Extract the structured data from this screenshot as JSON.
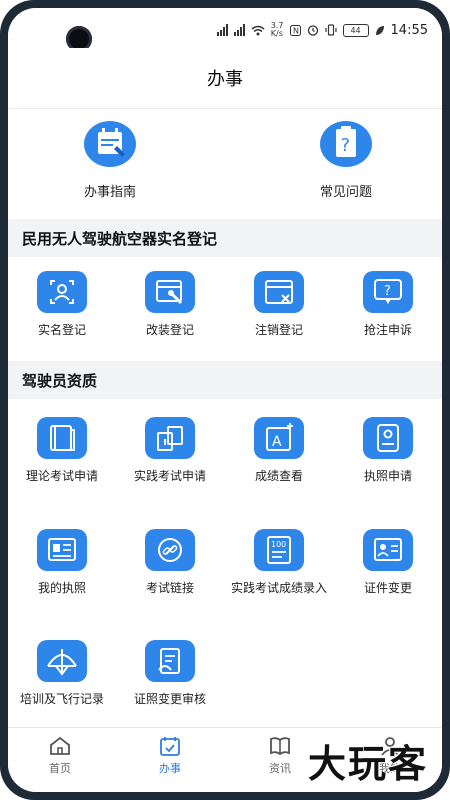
{
  "status": {
    "net": "3.7\nK/s",
    "battery": "44",
    "time": "14:55"
  },
  "header": {
    "title": "办事"
  },
  "quick": [
    {
      "label": "办事指南",
      "icon": "guide-icon"
    },
    {
      "label": "常见问题",
      "icon": "faq-icon"
    }
  ],
  "sections": [
    {
      "title": "民用无人驾驶航空器实名登记",
      "items": [
        {
          "label": "实名登记",
          "icon": "face-scan-icon"
        },
        {
          "label": "改装登记",
          "icon": "modify-icon"
        },
        {
          "label": "注销登记",
          "icon": "cancel-icon"
        },
        {
          "label": "抢注申诉",
          "icon": "appeal-icon"
        }
      ]
    },
    {
      "title": "驾驶员资质",
      "items": [
        {
          "label": "理论考试申请",
          "icon": "book-icon"
        },
        {
          "label": "实践考试申请",
          "icon": "practice-icon"
        },
        {
          "label": "成绩查看",
          "icon": "grade-icon"
        },
        {
          "label": "执照申请",
          "icon": "license-apply-icon"
        },
        {
          "label": "我的执照",
          "icon": "my-license-icon"
        },
        {
          "label": "考试链接",
          "icon": "link-icon"
        },
        {
          "label": "实践考试成绩录入",
          "icon": "score-entry-icon"
        },
        {
          "label": "证件变更",
          "icon": "cert-change-icon"
        },
        {
          "label": "培训及飞行记录",
          "icon": "flight-record-icon"
        },
        {
          "label": "证照变更审核",
          "icon": "review-icon"
        }
      ]
    }
  ],
  "tabs": [
    {
      "label": "首页",
      "icon": "home-icon",
      "active": false
    },
    {
      "label": "办事",
      "icon": "calendar-check-icon",
      "active": true
    },
    {
      "label": "资讯",
      "icon": "book-open-icon",
      "active": false
    },
    {
      "label": "我的",
      "icon": "user-icon",
      "active": false
    }
  ],
  "watermark": "大玩客",
  "colors": {
    "accent": "#2f86ea",
    "tab_active": "#2f7de1"
  }
}
